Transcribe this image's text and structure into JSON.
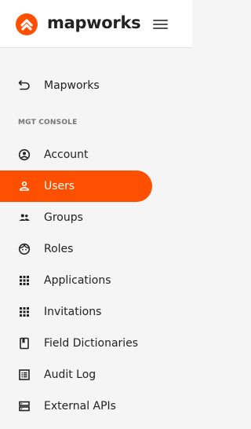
{
  "brand": {
    "name": "mapworks",
    "accent_color": "#ff4f00"
  },
  "header": {
    "menu_icon": "hamburger-menu-icon"
  },
  "sidebar": {
    "back_item": {
      "label": "Mapworks",
      "icon": "back-arrow-icon"
    },
    "section_title": "MGT CONSOLE",
    "items": [
      {
        "label": "Account",
        "icon": "account-circle-icon",
        "active": false
      },
      {
        "label": "Users",
        "icon": "person-icon",
        "active": true
      },
      {
        "label": "Groups",
        "icon": "group-icon",
        "active": false
      },
      {
        "label": "Roles",
        "icon": "face-icon",
        "active": false
      },
      {
        "label": "Applications",
        "icon": "apps-grid-icon",
        "active": false
      },
      {
        "label": "Invitations",
        "icon": "apps-grid-icon",
        "active": false
      },
      {
        "label": "Field Dictionaries",
        "icon": "book-icon",
        "active": false
      },
      {
        "label": "Audit Log",
        "icon": "list-alt-icon",
        "active": false
      },
      {
        "label": "External APIs",
        "icon": "storage-icon",
        "active": false
      }
    ]
  }
}
